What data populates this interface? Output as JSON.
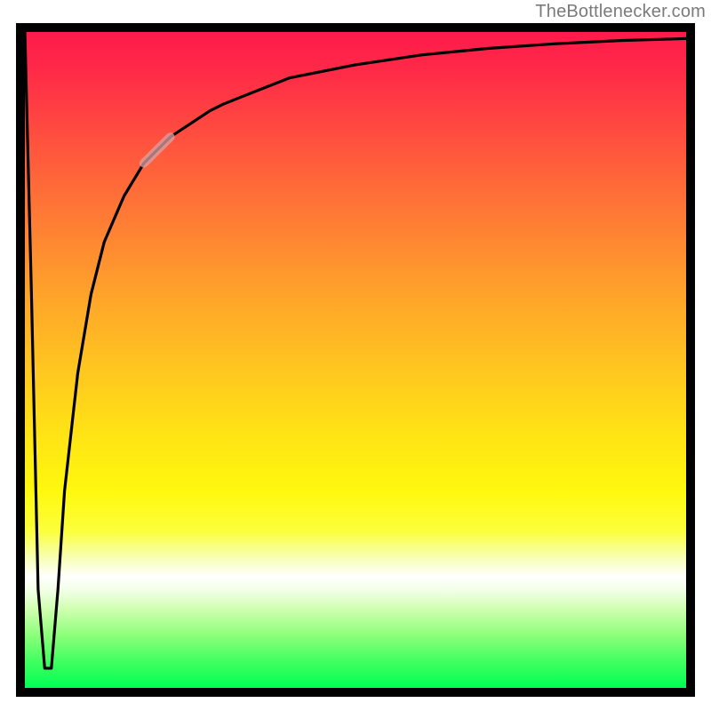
{
  "attribution": "TheBottlenecker.com",
  "colors": {
    "frame": "#000000",
    "curve": "#000000",
    "highlight": "#d9a1a6",
    "gradient_top": "#ff1a4b",
    "gradient_bottom": "#00ff55"
  },
  "chart_data": {
    "type": "line",
    "title": "",
    "xlabel": "",
    "ylabel": "",
    "xlim": [
      0,
      100
    ],
    "ylim": [
      0,
      100
    ],
    "grid": false,
    "legend_position": "none",
    "series": [
      {
        "name": "bottleneck-curve",
        "x": [
          0,
          1,
          2,
          3,
          4,
          5,
          6,
          8,
          10,
          12,
          15,
          18,
          20,
          22,
          25,
          28,
          30,
          35,
          40,
          50,
          60,
          70,
          80,
          90,
          100
        ],
        "y": [
          100,
          60,
          15,
          3,
          3,
          15,
          30,
          48,
          60,
          68,
          75,
          80,
          82,
          84,
          86,
          88,
          89,
          91,
          93,
          95,
          96.5,
          97.5,
          98.2,
          98.7,
          99
        ]
      }
    ],
    "annotations": [
      {
        "name": "highlight-segment",
        "kind": "line-segment-overlay",
        "x_start": 18,
        "x_end": 22,
        "note": "pale pink thicker stroke over curve in this x-range"
      }
    ]
  }
}
